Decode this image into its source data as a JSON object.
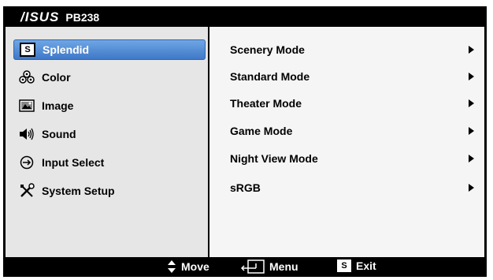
{
  "header": {
    "brand": "/ISUS",
    "model": "PB238"
  },
  "menu": {
    "items": [
      {
        "label": "Splendid",
        "icon": "splendid-s-icon",
        "glyph": "S"
      },
      {
        "label": "Color",
        "icon": "color-icon"
      },
      {
        "label": "Image",
        "icon": "image-icon"
      },
      {
        "label": "Sound",
        "icon": "speaker-icon"
      },
      {
        "label": "Input Select",
        "icon": "input-select-icon"
      },
      {
        "label": "System Setup",
        "icon": "tools-icon"
      }
    ],
    "selected": "Splendid"
  },
  "modes": [
    {
      "label": "Scenery Mode"
    },
    {
      "label": "Standard Mode"
    },
    {
      "label": "Theater Mode"
    },
    {
      "label": "Game Mode"
    },
    {
      "label": "Night View Mode"
    },
    {
      "label": "sRGB"
    }
  ],
  "footer": {
    "move": "Move",
    "menu": "Menu",
    "exit": "Exit",
    "exit_glyph": "S"
  },
  "colors": {
    "selection": "#4f88d6",
    "background": "#e6e6e6",
    "panel": "#f5f5f5",
    "frame": "#000000"
  }
}
